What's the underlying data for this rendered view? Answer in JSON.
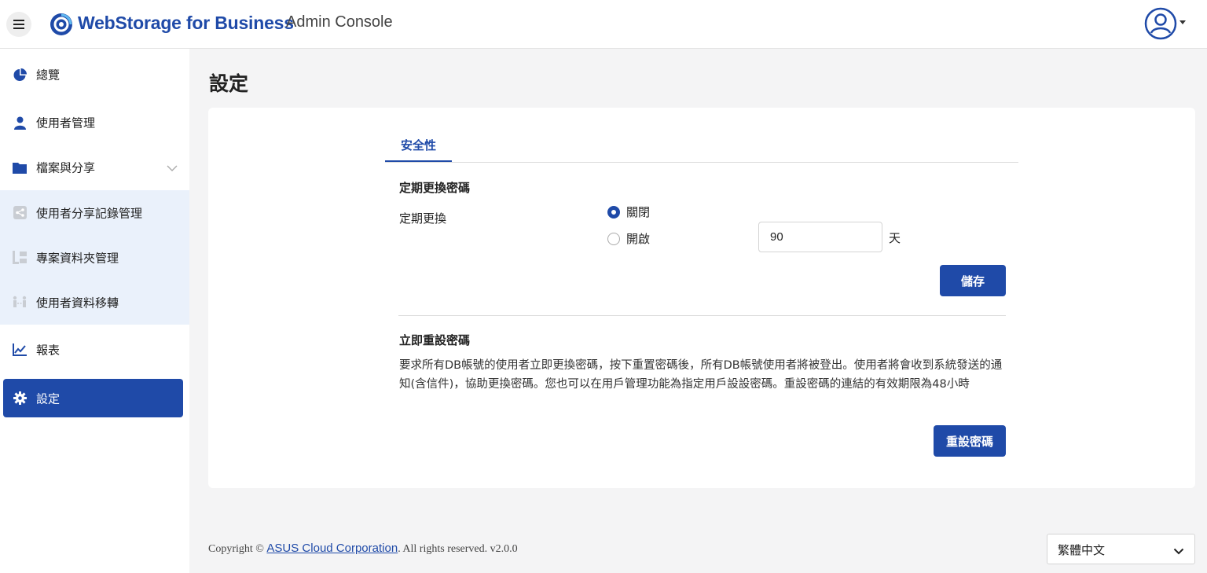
{
  "header": {
    "brand": "WebStorage for Business",
    "subtitle": "Admin Console"
  },
  "sidebar": {
    "items": [
      {
        "label": "總覽",
        "icon": "pie-chart-icon"
      },
      {
        "label": "使用者管理",
        "icon": "user-icon"
      },
      {
        "label": "檔案與分享",
        "icon": "folder-icon",
        "expanded": true
      },
      {
        "label": "使用者分享記錄管理",
        "icon": "share-icon"
      },
      {
        "label": "專案資料夾管理",
        "icon": "project-folder-icon"
      },
      {
        "label": "使用者資料移轉",
        "icon": "transfer-icon"
      },
      {
        "label": "報表",
        "icon": "line-chart-icon"
      },
      {
        "label": "設定",
        "icon": "gear-icon",
        "active": true
      }
    ]
  },
  "main": {
    "title": "設定",
    "tab": "安全性",
    "periodic": {
      "section_title": "定期更換密碼",
      "field_label": "定期更換",
      "option_off": "關閉",
      "option_on": "開啟",
      "selected": "關閉",
      "days_value": "90",
      "days_unit": "天",
      "save_label": "儲存"
    },
    "reset": {
      "section_title": "立即重設密碼",
      "description": "要求所有DB帳號的使用者立即更換密碼，按下重置密碼後，所有DB帳號使用者將被登出。使用者將會收到系統發送的通知(含信件)，協助更換密碼。您也可以在用戶管理功能為指定用戶設設密碼。重設密碼的連結的有效期限為48小時",
      "button_label": "重設密碼"
    }
  },
  "footer": {
    "copyright_prefix": "Copyright ©",
    "company": "ASUS Cloud Corporation",
    "suffix": ". All rights reserved. v2.0.0",
    "language": "繁體中文"
  },
  "colors": {
    "accent": "#1f4aa8",
    "sub_menu_bg": "#eaf1fb",
    "page_bg": "#f4f4f5"
  }
}
